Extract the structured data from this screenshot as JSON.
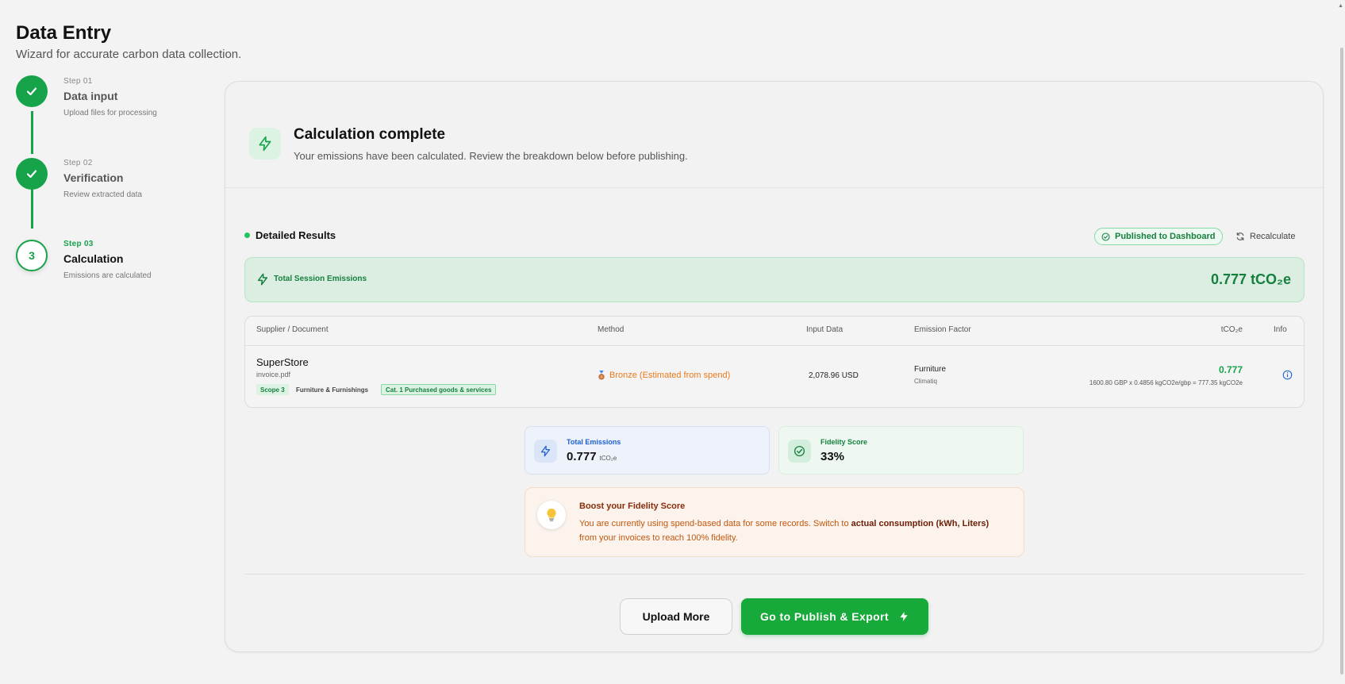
{
  "header": {
    "title": "Data Entry",
    "subtitle": "Wizard for accurate carbon data collection."
  },
  "steps": [
    {
      "num": "Step 01",
      "title": "Data input",
      "desc": "Upload files for processing",
      "status": "done"
    },
    {
      "num": "Step 02",
      "title": "Verification",
      "desc": "Review extracted data",
      "status": "done"
    },
    {
      "num": "Step 03",
      "title": "Calculation",
      "desc": "Emissions are calculated",
      "status": "active",
      "badge": "3"
    }
  ],
  "calc": {
    "title": "Calculation complete",
    "subtitle": "Your emissions have been calculated. Review the breakdown below before publishing."
  },
  "results": {
    "title": "Detailed Results",
    "published_label": "Published to Dashboard",
    "recalculate_label": "Recalculate",
    "total_label": "Total Session Emissions",
    "total_value": "0.777 tCO₂e"
  },
  "table": {
    "headers": {
      "supplier": "Supplier / Document",
      "method": "Method",
      "input": "Input Data",
      "factor": "Emission Factor",
      "tco2": "tCO₂e",
      "info": "Info"
    },
    "row": {
      "supplier": "SuperStore",
      "file": "invoice.pdf",
      "tag_scope": "Scope 3",
      "tag_category": "Furniture & Furnishings",
      "tag_cat": "Cat. 1 Purchased goods & services",
      "method": "Bronze (Estimated from spend)",
      "input": "2,078.96 USD",
      "factor_main": "Furniture",
      "factor_source": "Climatiq",
      "tco2": "0.777",
      "formula": "1600.80 GBP x 0.4856 kgCO2e/gbp = 777.35 kgCO2e"
    }
  },
  "stats": {
    "total_label": "Total Emissions",
    "total_value": "0.777",
    "total_unit": "tCO₂e",
    "fidelity_label": "Fidelity Score",
    "fidelity_value": "33%"
  },
  "boost": {
    "title": "Boost your Fidelity Score",
    "text_1": "You are currently using spend-based data for some records. Switch to ",
    "text_bold": "actual consumption (kWh, Liters)",
    "text_2": " from your invoices to reach 100% fidelity."
  },
  "actions": {
    "upload_more": "Upload More",
    "publish": "Go to Publish & Export"
  },
  "colors": {
    "accent": "#16a34a",
    "method_bronze": "#ea7a1c",
    "info_blue": "#1d5fd1"
  },
  "icons": {
    "calc": "lightning-icon",
    "check": "check-icon",
    "refresh": "refresh-icon",
    "info": "info-icon",
    "bulb": "lightbulb-icon",
    "medal": "medal-icon"
  }
}
